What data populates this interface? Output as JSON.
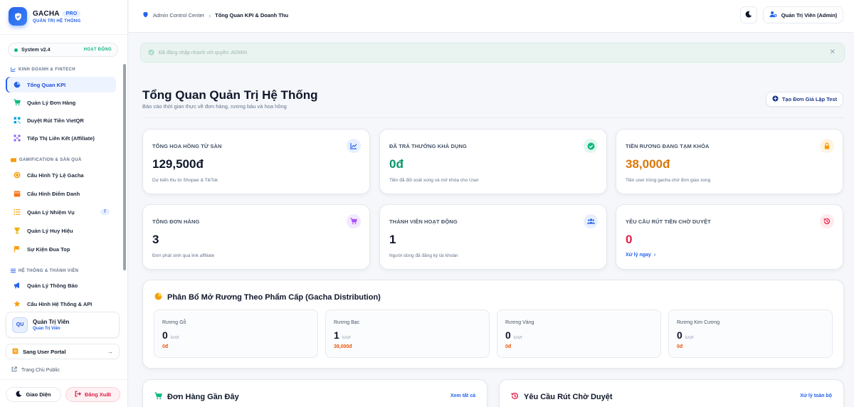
{
  "brand": {
    "name": "GACHA",
    "badge": "PRO",
    "subtitle": "QUẢN TRỊ HỆ THỐNG"
  },
  "system": {
    "version": "System v2.4",
    "status": "HOẠT ĐỘNG"
  },
  "sidebar": {
    "sections": [
      {
        "title": "KINH DOANH & FINTECH"
      },
      {
        "title": "GAMIFICATION & SĂN QUÀ"
      },
      {
        "title": "HỆ THỐNG & THÀNH VIÊN"
      }
    ],
    "items": [
      {
        "label": "Tổng Quan KPI",
        "icon": "pie-chart-icon"
      },
      {
        "label": "Quản Lý Đơn Hàng",
        "icon": "cart-icon"
      },
      {
        "label": "Duyệt Rút Tiền VietQR",
        "icon": "qr-code-icon"
      },
      {
        "label": "Tiếp Thị Liên Kết (Affiliate)",
        "icon": "network-icon"
      },
      {
        "label": "Cấu Hình Tỷ Lệ Gacha",
        "icon": "coin-icon"
      },
      {
        "label": "Cấu Hình Điểm Danh",
        "icon": "calendar-icon"
      },
      {
        "label": "Quản Lý Nhiệm Vụ",
        "icon": "task-list-icon",
        "count": "7"
      },
      {
        "label": "Quản Lý Huy Hiệu",
        "icon": "trophy-icon"
      },
      {
        "label": "Sự Kiện Đua Top",
        "icon": "flag-icon"
      },
      {
        "label": "Quản Lý Thông Báo",
        "icon": "megaphone-icon"
      },
      {
        "label": "Cấu Hình Hệ Thống & API",
        "icon": "star-gear-icon"
      }
    ]
  },
  "user": {
    "initials": "QU",
    "name": "Quản Trị Viên",
    "role": "Quản Trị Viên"
  },
  "portal_button": "Sang User Portal",
  "home_link": "Trang Chủ Public",
  "theme_button": "Giao Diện",
  "logout_button": "Đăng Xuất",
  "header": {
    "breadcrumb_root": "Admin Control Center",
    "breadcrumb_current": "Tổng Quan KPI & Doanh Thu",
    "admin_button": "Quản Trị Viên (Admin)"
  },
  "alert": {
    "text": "Đã đăng nhập nhanh với quyền: ADMIN"
  },
  "page": {
    "title": "Tổng Quan Quản Trị Hệ Thống",
    "subtitle": "Báo cáo thời gian thực về đơn hàng, rương báu và hoa hồng",
    "create_button": "Tạo Đơn Giả Lập Test"
  },
  "kpis": [
    {
      "label": "TỔNG HOA HỒNG TỪ SÀN",
      "value": "129,500đ",
      "note": "Dự kiến thu từ Shopee & TikTok",
      "icon": "trend-chart-icon",
      "value_color": "#0f172a",
      "icon_bg": "#e8efff",
      "icon_color": "#2563eb"
    },
    {
      "label": "ĐÃ TRẢ THƯỞNG KHẢ DỤNG",
      "value": "0đ",
      "note": "Tiền đã đối soát xong và mở khóa cho User",
      "icon": "check-circle-icon",
      "value_color": "#059669",
      "icon_bg": "#e3f7ee",
      "icon_color": "#10b981"
    },
    {
      "label": "TIỀN RƯƠNG ĐANG TẠM KHÓA",
      "value": "38,000đ",
      "note": "Tiền user trúng gacha chờ đơn giao xong",
      "icon": "lock-icon",
      "value_color": "#d97706",
      "icon_bg": "#fff4e0",
      "icon_color": "#f59e0b"
    },
    {
      "label": "TỔNG ĐƠN HÀNG",
      "value": "3",
      "note": "Đơn phát sinh qua link affiliate",
      "icon": "cart-icon",
      "value_color": "#0f172a",
      "icon_bg": "#f3e8ff",
      "icon_color": "#a855f7"
    },
    {
      "label": "THÀNH VIÊN HOẠT ĐỘNG",
      "value": "1",
      "note": "Người dùng đã đăng ký tài khoản",
      "icon": "users-icon",
      "value_color": "#0f172a",
      "icon_bg": "#e8efff",
      "icon_color": "#2563eb"
    },
    {
      "label": "YÊU CẦU RÚT TIỀN CHỜ DUYỆT",
      "value": "0",
      "link": "Xử lý ngay",
      "icon": "history-icon",
      "value_color": "#e11d48",
      "icon_bg": "#ffe9ec",
      "icon_color": "#e11d48"
    }
  ],
  "distribution": {
    "title": "Phân Bổ Mở Rương Theo Phẩm Cấp (Gacha Distribution)",
    "unit": "lượt",
    "chests": [
      {
        "name": "Rương Gỗ",
        "count": "0",
        "amount": "0đ"
      },
      {
        "name": "Rương Bạc",
        "count": "1",
        "amount": "38,000đ"
      },
      {
        "name": "Rương Vàng",
        "count": "0",
        "amount": "0đ"
      },
      {
        "name": "Rương Kim Cương",
        "count": "0",
        "amount": "0đ"
      }
    ]
  },
  "recent_orders": {
    "title": "Đơn Hàng Gần Đây",
    "link": "Xem tất cả"
  },
  "pending_withdrawals": {
    "title": "Yêu Cầu Rút Chờ Duyệt",
    "link": "Xử lý toàn bộ"
  }
}
